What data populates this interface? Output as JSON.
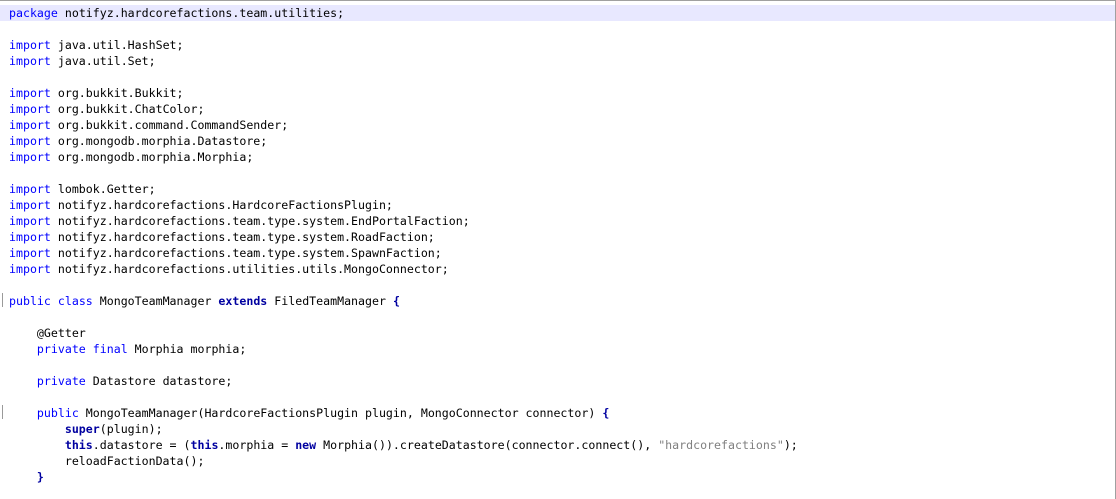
{
  "editor": {
    "lines": [
      [
        {
          "t": "package",
          "c": "kw"
        },
        {
          "t": " notifyz.hardcorefactions.team.utilities;",
          "c": "pl"
        }
      ],
      [],
      [
        {
          "t": "import",
          "c": "kw"
        },
        {
          "t": " java.util.HashSet;",
          "c": "pl"
        }
      ],
      [
        {
          "t": "import",
          "c": "kw"
        },
        {
          "t": " java.util.Set;",
          "c": "pl"
        }
      ],
      [],
      [
        {
          "t": "import",
          "c": "kw"
        },
        {
          "t": " org.bukkit.Bukkit;",
          "c": "pl"
        }
      ],
      [
        {
          "t": "import",
          "c": "kw"
        },
        {
          "t": " org.bukkit.ChatColor;",
          "c": "pl"
        }
      ],
      [
        {
          "t": "import",
          "c": "kw"
        },
        {
          "t": " org.bukkit.command.CommandSender;",
          "c": "pl"
        }
      ],
      [
        {
          "t": "import",
          "c": "kw"
        },
        {
          "t": " org.mongodb.morphia.Datastore;",
          "c": "pl"
        }
      ],
      [
        {
          "t": "import",
          "c": "kw"
        },
        {
          "t": " org.mongodb.morphia.Morphia;",
          "c": "pl"
        }
      ],
      [],
      [
        {
          "t": "import",
          "c": "kw"
        },
        {
          "t": " lombok.Getter;",
          "c": "pl"
        }
      ],
      [
        {
          "t": "import",
          "c": "kw"
        },
        {
          "t": " notifyz.hardcorefactions.HardcoreFactionsPlugin;",
          "c": "pl"
        }
      ],
      [
        {
          "t": "import",
          "c": "kw"
        },
        {
          "t": " notifyz.hardcorefactions.team.type.system.EndPortalFaction;",
          "c": "pl"
        }
      ],
      [
        {
          "t": "import",
          "c": "kw"
        },
        {
          "t": " notifyz.hardcorefactions.team.type.system.RoadFaction;",
          "c": "pl"
        }
      ],
      [
        {
          "t": "import",
          "c": "kw"
        },
        {
          "t": " notifyz.hardcorefactions.team.type.system.SpawnFaction;",
          "c": "pl"
        }
      ],
      [
        {
          "t": "import",
          "c": "kw"
        },
        {
          "t": " notifyz.hardcorefactions.utilities.utils.MongoConnector;",
          "c": "pl"
        }
      ],
      [],
      [
        {
          "t": "public",
          "c": "kw"
        },
        {
          "t": " ",
          "c": "pl"
        },
        {
          "t": "class",
          "c": "kw"
        },
        {
          "t": " MongoTeamManager ",
          "c": "pl"
        },
        {
          "t": "extends",
          "c": "kwb"
        },
        {
          "t": " FiledTeamManager ",
          "c": "pl"
        },
        {
          "t": "{",
          "c": "kwb"
        }
      ],
      [],
      [
        {
          "t": "    @Getter",
          "c": "anno"
        }
      ],
      [
        {
          "t": "    ",
          "c": "pl"
        },
        {
          "t": "private",
          "c": "kw"
        },
        {
          "t": " ",
          "c": "pl"
        },
        {
          "t": "final",
          "c": "kw"
        },
        {
          "t": " Morphia morphia;",
          "c": "pl"
        }
      ],
      [],
      [
        {
          "t": "    ",
          "c": "pl"
        },
        {
          "t": "private",
          "c": "kw"
        },
        {
          "t": " Datastore datastore;",
          "c": "pl"
        }
      ],
      [],
      [
        {
          "t": "    ",
          "c": "pl"
        },
        {
          "t": "public",
          "c": "kw"
        },
        {
          "t": " MongoTeamManager(HardcoreFactionsPlugin plugin, MongoConnector connector) ",
          "c": "pl"
        },
        {
          "t": "{",
          "c": "kwb"
        }
      ],
      [
        {
          "t": "        ",
          "c": "pl"
        },
        {
          "t": "super",
          "c": "kwb"
        },
        {
          "t": "(plugin);",
          "c": "pl"
        }
      ],
      [
        {
          "t": "        ",
          "c": "pl"
        },
        {
          "t": "this",
          "c": "kwb"
        },
        {
          "t": ".datastore = (",
          "c": "pl"
        },
        {
          "t": "this",
          "c": "kwb"
        },
        {
          "t": ".morphia = ",
          "c": "pl"
        },
        {
          "t": "new",
          "c": "kwb"
        },
        {
          "t": " Morphia()).createDatastore(connector.connect(), ",
          "c": "pl"
        },
        {
          "t": "\"hardcorefactions\"",
          "c": "str"
        },
        {
          "t": ");",
          "c": "pl"
        }
      ],
      [
        {
          "t": "        reloadFactionData();",
          "c": "pl"
        }
      ],
      [
        {
          "t": "    }",
          "c": "kwb"
        }
      ]
    ],
    "current_line": 0,
    "colors": {
      "keyword": "#0000ff",
      "keyword_bold": "#0000a0",
      "string": "#808080",
      "current_line_bg": "#e8e8ff"
    }
  }
}
